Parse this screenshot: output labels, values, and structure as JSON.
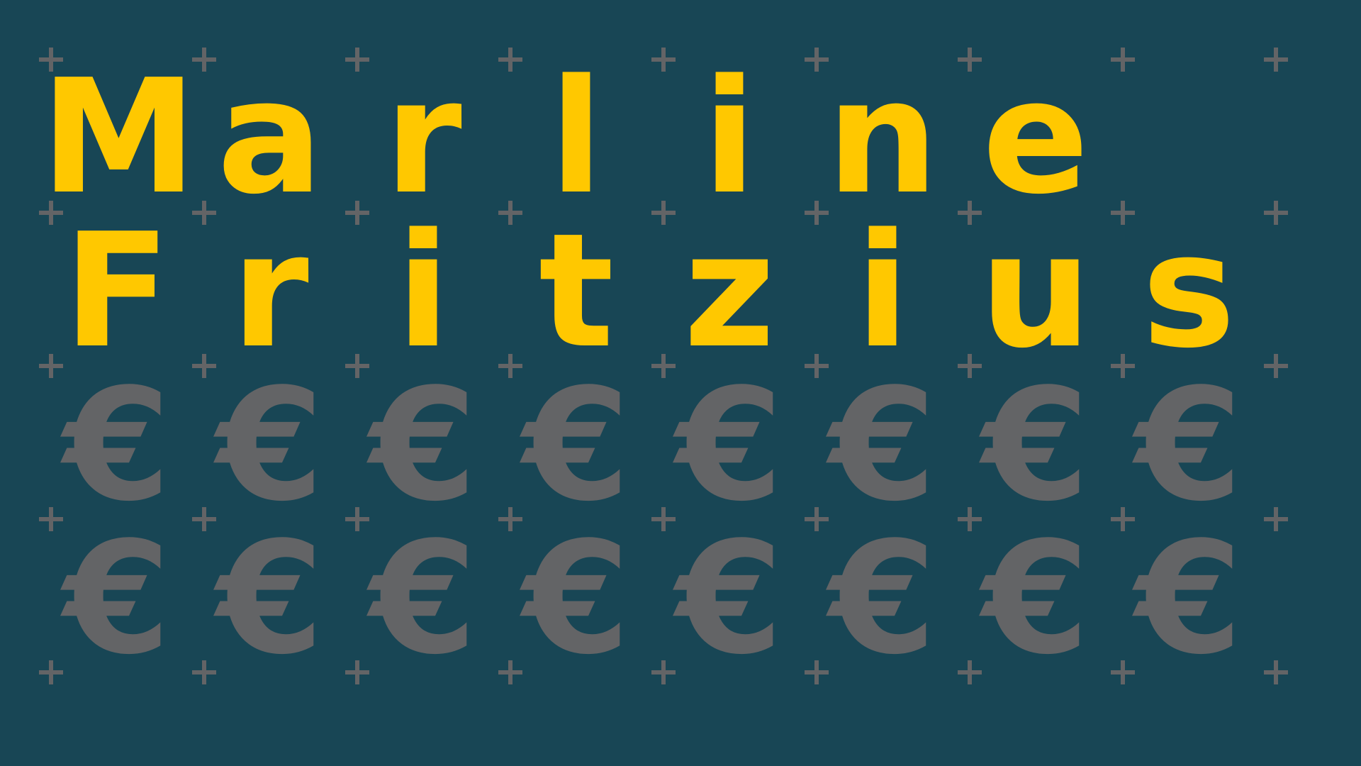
{
  "name_lines": [
    "Marline",
    "Fritzius"
  ],
  "euro_symbol": "€",
  "euro_rows": 2,
  "euro_cols": 8,
  "colors": {
    "background": "#184655",
    "name": "#ffc800",
    "euro": "#636466",
    "plus": "#636466"
  }
}
